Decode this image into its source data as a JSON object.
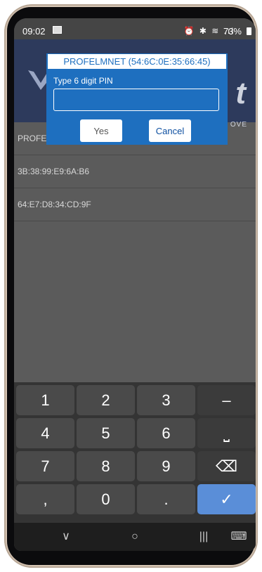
{
  "status": {
    "time": "09:02",
    "icons": "⏰ ✱ ≋ .ıl",
    "battery": "73%"
  },
  "app": {
    "logo_letter": "t",
    "logo_subtitle": "OVE"
  },
  "devices": [
    {
      "label": "PROFE"
    },
    {
      "label": "3B:38:99:E9:6A:B6"
    },
    {
      "label": "64:E7:D8:34:CD:9F"
    }
  ],
  "dialog": {
    "title": "PROFELMNET (54:6C:0E:35:66:45)",
    "label": "Type 6 digit PIN",
    "input_value": "",
    "yes_label": "Yes",
    "cancel_label": "Cancel"
  },
  "keypad": {
    "keys": [
      "1",
      "2",
      "3",
      "–",
      "4",
      "5",
      "6",
      "⎵",
      "7",
      "8",
      "9",
      "⌫",
      ",",
      "0",
      ".",
      "✓"
    ]
  },
  "nav": {
    "back": "∨",
    "home": "○",
    "recents": "|||",
    "keyboard": "⌨"
  },
  "colors": {
    "dialog": "#1e6fbf",
    "done_key": "#5a8ed8"
  }
}
